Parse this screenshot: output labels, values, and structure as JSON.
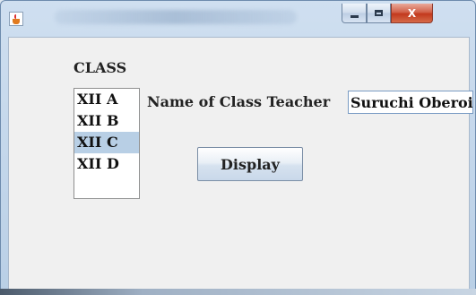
{
  "window": {
    "title": "",
    "app_icon": "java-cup-icon",
    "controls": {
      "minimize_icon": "minimize-icon",
      "maximize_icon": "maximize-icon",
      "close_label": "X"
    }
  },
  "form": {
    "class_label": "CLASS",
    "classes": [
      {
        "label": "XII A",
        "selected": false
      },
      {
        "label": "XII B",
        "selected": false
      },
      {
        "label": "XII C",
        "selected": true
      },
      {
        "label": "XII D",
        "selected": false
      }
    ],
    "teacher_label": "Name of Class Teacher",
    "teacher_value": "Suruchi Oberoi",
    "display_button": "Display"
  },
  "colors": {
    "selection": "#b8cfe5",
    "close_button": "#c2391d"
  }
}
